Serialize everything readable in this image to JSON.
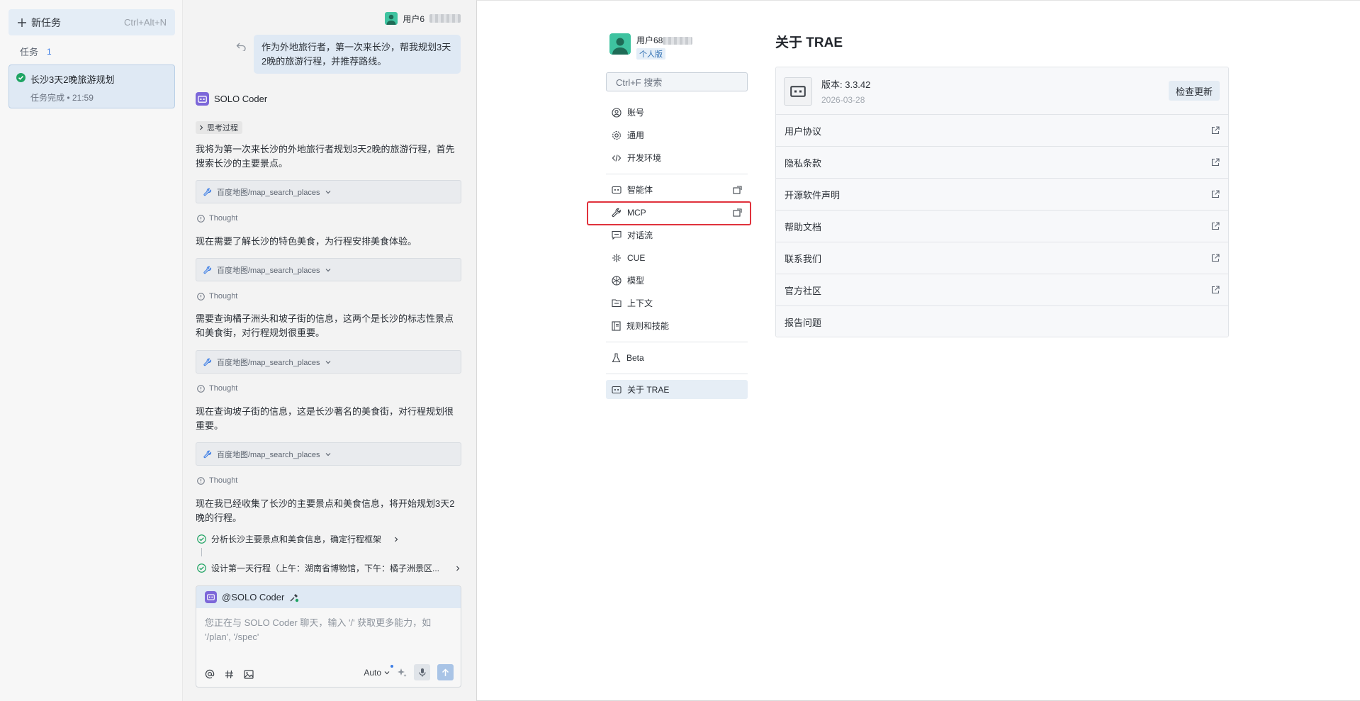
{
  "sidebar": {
    "new_task_label": "新任务",
    "new_task_shortcut": "Ctrl+Alt+N",
    "tasks_label": "任务",
    "tasks_count": "1",
    "task": {
      "title": "长沙3天2晚旅游规划",
      "status": "任务完成 • 21:59"
    }
  },
  "chat": {
    "user_name": "用户6",
    "user_message": "作为外地旅行者，第一次来长沙，帮我规划3天2晚的旅游行程，并推荐路线。",
    "agent_name": "SOLO Coder",
    "think_label": "思考过程",
    "para1": "我将为第一次来长沙的外地旅行者规划3天2晚的旅游行程，首先搜索长沙的主要景点。",
    "tool_label": "百度地图/map_search_places",
    "thought_label": "Thought",
    "para2": "现在需要了解长沙的特色美食，为行程安排美食体验。",
    "para3": "需要查询橘子洲头和坡子街的信息，这两个是长沙的标志性景点和美食街，对行程规划很重要。",
    "para4": "现在查询坡子街的信息，这是长沙著名的美食街，对行程规划很重要。",
    "para5": "现在我已经收集了长沙的主要景点和美食信息，将开始规划3天2晚的行程。",
    "step1": "分析长沙主要景点和美食信息，确定行程框架",
    "step2": "设计第一天行程（上午：湖南省博物馆，下午：橘子洲景区..."
  },
  "composer": {
    "mention": "@SOLO Coder",
    "placeholder": "您正在与 SOLO Coder 聊天，输入 '/' 获取更多能力，如 '/plan', '/spec'",
    "mode": "Auto"
  },
  "settings": {
    "profile_name": "用户68",
    "profile_plan": "个人版",
    "search_placeholder": "Ctrl+F 搜索",
    "nav": {
      "account": "账号",
      "general": "通用",
      "dev_env": "开发环境",
      "agents": "智能体",
      "mcp": "MCP",
      "dialog_flow": "对话流",
      "cue": "CUE",
      "models": "模型",
      "context": "上下文",
      "rules_skills": "规则和技能",
      "beta": "Beta",
      "about": "关于 TRAE"
    },
    "about": {
      "title": "关于 TRAE",
      "version": "版本: 3.3.42",
      "date": "2026-03-28",
      "check_update": "检查更新",
      "links": [
        "用户协议",
        "隐私条款",
        "开源软件声明",
        "帮助文档",
        "联系我们",
        "官方社区",
        "报告问题"
      ]
    }
  },
  "colors": {
    "accent": "#3d7ee6",
    "highlight": "#e0323c",
    "success": "#1fa463"
  }
}
